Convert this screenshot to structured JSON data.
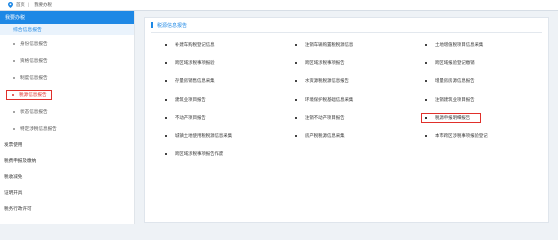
{
  "breadcrumb": {
    "home": "首页",
    "current": "我要办税"
  },
  "sidebar": {
    "header": "我要办税",
    "sub": "综合信息报告",
    "items": [
      {
        "label": "身份信息报告"
      },
      {
        "label": "资格信息报告"
      },
      {
        "label": "制度信息报告"
      },
      {
        "label": "税源信息报告",
        "active": true
      },
      {
        "label": "状态信息报告"
      },
      {
        "label": "特定涉税信息报告"
      }
    ],
    "sections": [
      {
        "label": "发票使用"
      },
      {
        "label": "税费申报及缴纳"
      },
      {
        "label": "税收减免"
      },
      {
        "label": "证明开具"
      },
      {
        "label": "税务行政许可"
      }
    ]
  },
  "main": {
    "title": "税源信息报告",
    "items": [
      {
        "label": "补建车购税登记信息"
      },
      {
        "label": "注销车辆购置税税源信息"
      },
      {
        "label": "土地增值税项目信息采集"
      },
      {
        "label": "跨区域涉税事项报验"
      },
      {
        "label": "跨区域涉税事项报告"
      },
      {
        "label": "跨区域报验登记缴销"
      },
      {
        "label": "存量房销售信息采集"
      },
      {
        "label": "水资源税税源信息报告"
      },
      {
        "label": "增量房房源信息报告"
      },
      {
        "label": "建筑业项目报告"
      },
      {
        "label": "环境保护税基础信息采集"
      },
      {
        "label": "注销建筑业项目报告"
      },
      {
        "label": "不动产项目报告"
      },
      {
        "label": "注销不动产项目报告"
      },
      {
        "label": "税源申报明细报告",
        "highlight": true
      },
      {
        "label": "城镇土地使用税税源信息采集"
      },
      {
        "label": "房产税税源信息采集"
      },
      {
        "label": "本市跨区涉税事项报验登记"
      },
      {
        "label": "跨区域涉税事项报告作废"
      }
    ]
  },
  "colors": {
    "accent": "#1e88e5",
    "highlight": "#e0302b"
  },
  "icons": {
    "location": "map-pin-icon"
  }
}
